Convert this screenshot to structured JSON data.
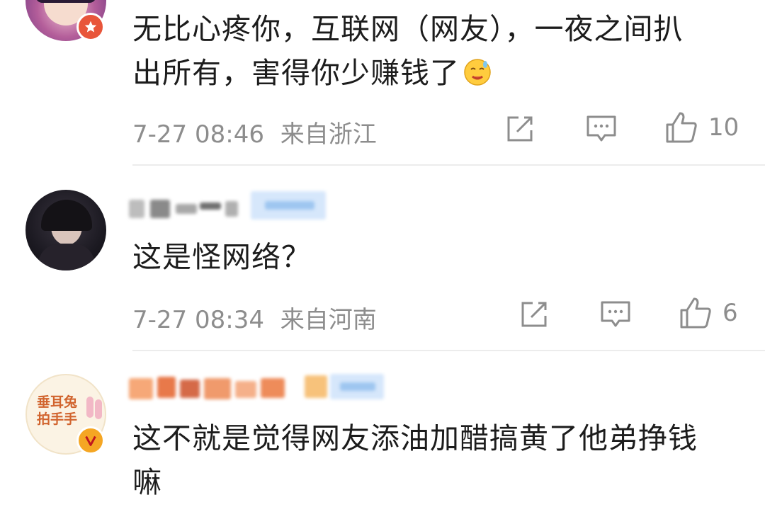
{
  "comments": [
    {
      "text_line1": "无比心疼你，互联网（网友），一夜之间扒",
      "text_line2": "出所有，害得你少赚钱了",
      "emoji": "sweating-face-emoji",
      "time": "7-27 08:46",
      "location": "来自浙江",
      "likes": "10",
      "avatar_badge": "star-badge-icon"
    },
    {
      "text_line1": "这是怪网络？",
      "time": "7-27 08:34",
      "location": "来自河南",
      "likes": "6"
    },
    {
      "text_line1": "这不就是觉得网友添油加醋搞黄了他弟挣钱",
      "text_line2": "嘛",
      "avatar_badge": "verified-v-icon",
      "avatar_text": "垂耳兔\n拍手手"
    }
  ],
  "colors": {
    "meta_gray": "#8d8d8d",
    "verified_orange": "#f5a623",
    "star_badge_red": "#e8553a"
  }
}
